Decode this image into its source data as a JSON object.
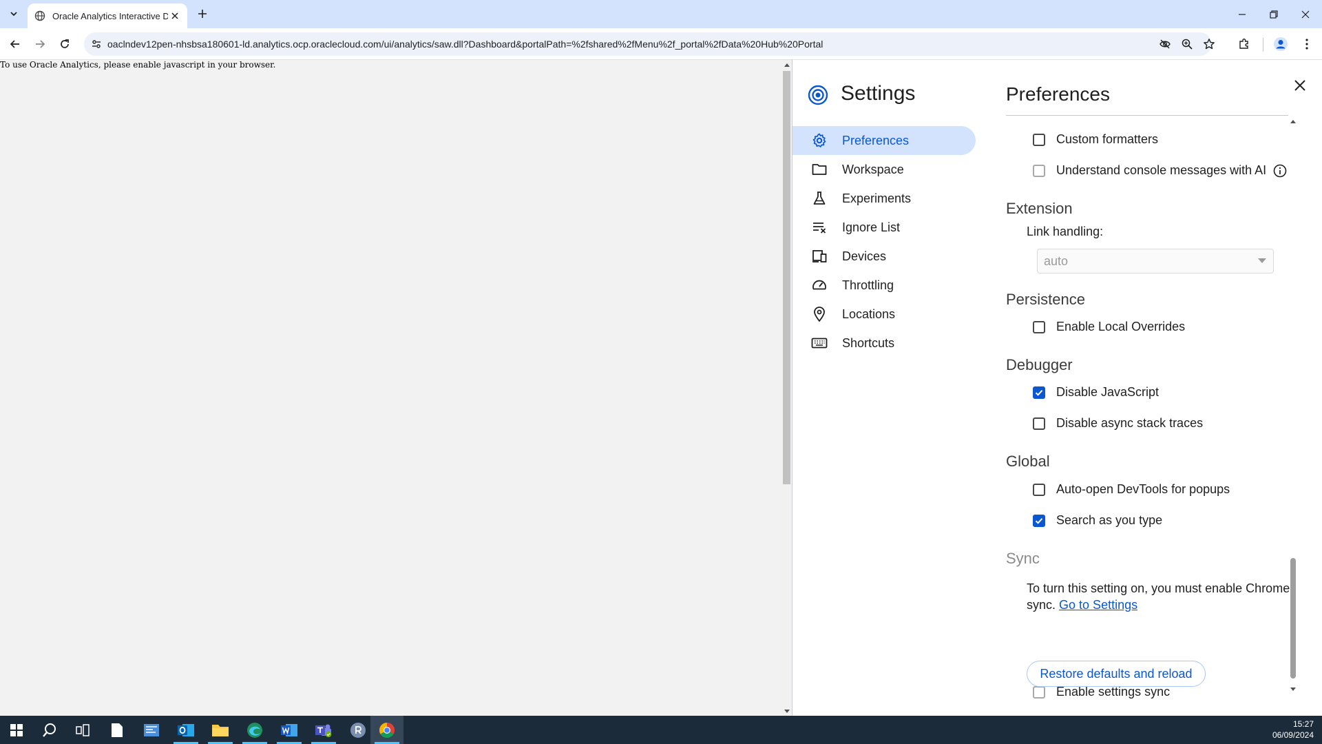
{
  "browser": {
    "tab_title": "Oracle Analytics Interactive Dashboards",
    "url": "oaclndev12pen-nhsbsa180601-ld.analytics.ocp.oraclecloud.com/ui/analytics/saw.dll?Dashboard&portalPath=%2fshared%2fMenu%2f_portal%2fData%20Hub%20Portal"
  },
  "page": {
    "message": "To use Oracle Analytics, please enable javascript in your browser."
  },
  "settings": {
    "title": "Settings",
    "nav": [
      {
        "label": "Preferences",
        "icon": "gear-icon"
      },
      {
        "label": "Workspace",
        "icon": "folder-icon"
      },
      {
        "label": "Experiments",
        "icon": "flask-icon"
      },
      {
        "label": "Ignore List",
        "icon": "ignore-list-icon"
      },
      {
        "label": "Devices",
        "icon": "devices-icon"
      },
      {
        "label": "Throttling",
        "icon": "speedometer-icon"
      },
      {
        "label": "Locations",
        "icon": "location-pin-icon"
      },
      {
        "label": "Shortcuts",
        "icon": "keyboard-icon"
      }
    ],
    "pane_title": "Preferences",
    "custom_formatters": "Custom formatters",
    "console_ai": "Understand console messages with AI",
    "extension": {
      "heading": "Extension",
      "link_handling_label": "Link handling:",
      "link_handling_value": "auto"
    },
    "persistence": {
      "heading": "Persistence",
      "local_overrides": "Enable Local Overrides"
    },
    "debugger": {
      "heading": "Debugger",
      "disable_js": "Disable JavaScript",
      "disable_async": "Disable async stack traces"
    },
    "global": {
      "heading": "Global",
      "auto_open": "Auto-open DevTools for popups",
      "search_as_you_type": "Search as you type"
    },
    "sync": {
      "heading": "Sync",
      "text": "To turn this setting on, you must enable Chrome sync.",
      "link": "Go to Settings",
      "enable_sync": "Enable settings sync"
    },
    "restore_button": "Restore defaults and reload"
  },
  "taskbar": {
    "time": "15:27",
    "date": "06/09/2024"
  },
  "colors": {
    "accent": "#0b57d0",
    "nav_active_bg": "#d3e3fd",
    "tabstrip_bg": "#d3e3fd",
    "taskbar_bg": "#1c2b3a"
  }
}
